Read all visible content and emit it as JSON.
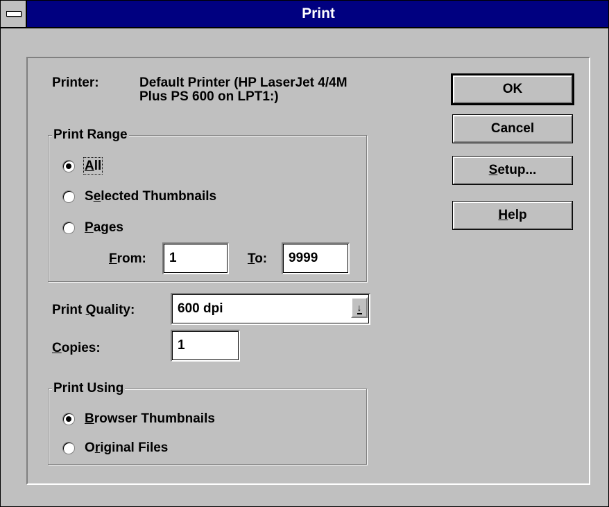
{
  "window": {
    "title": "Print"
  },
  "printer": {
    "label": "Printer:",
    "line1": "Default Printer (HP LaserJet 4/4M",
    "line2": "Plus PS 600 on LPT1:)"
  },
  "print_range": {
    "title": "Print Range",
    "all": {
      "pre": "",
      "key": "A",
      "post": "ll",
      "checked": true
    },
    "selected": {
      "pre": "S",
      "key": "e",
      "post": "lected Thumbnails",
      "checked": false
    },
    "pages": {
      "pre": "",
      "key": "P",
      "post": "ages",
      "checked": false
    },
    "from_label": {
      "pre": "",
      "key": "F",
      "post": "rom:"
    },
    "from_value": "1",
    "to_label": {
      "pre": "",
      "key": "T",
      "post": "o:"
    },
    "to_value": "9999"
  },
  "quality": {
    "label": {
      "pre": "Print ",
      "key": "Q",
      "post": "uality:"
    },
    "value": "600 dpi",
    "arrow": "↓"
  },
  "copies": {
    "label": {
      "pre": "",
      "key": "C",
      "post": "opies:"
    },
    "value": "1"
  },
  "print_using": {
    "title": "Print Using",
    "browser": {
      "pre": "",
      "key": "B",
      "post": "rowser Thumbnails",
      "checked": true
    },
    "original": {
      "pre": "O",
      "key": "r",
      "post": "iginal Files",
      "checked": false
    }
  },
  "buttons": {
    "ok": "OK",
    "cancel": "Cancel",
    "setup": {
      "pre": "",
      "key": "S",
      "post": "etup..."
    },
    "help": {
      "pre": "",
      "key": "H",
      "post": "elp"
    }
  }
}
